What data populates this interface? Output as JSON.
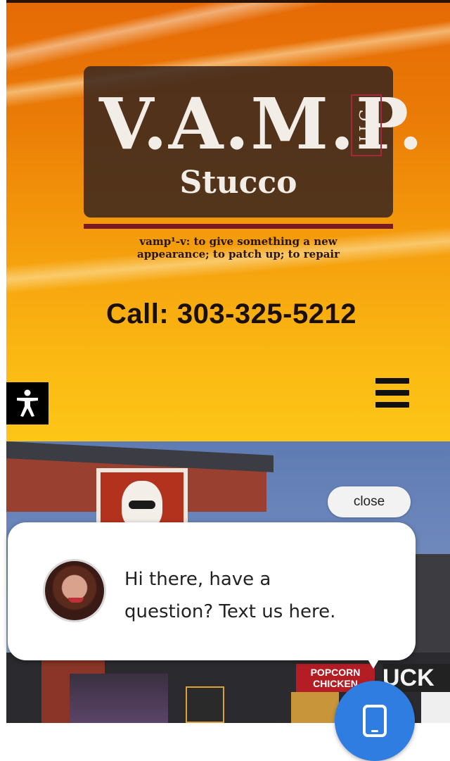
{
  "header": {
    "logo": {
      "letters": "V.A.M.P.",
      "llc": "LLC",
      "stucco": "Stucco"
    },
    "tagline_line1": "vamp¹-v: to give something a new",
    "tagline_line2": "appearance; to patch up; to repair",
    "call": "Call: 303-325-5212"
  },
  "icons": {
    "accessibility": "accessibility-icon",
    "menu": "hamburger-menu-icon",
    "phone": "mobile-phone-icon"
  },
  "hero_photo": {
    "signage_popcorn": "POPCORN\nCHICKEN",
    "signage_partial": "UCK"
  },
  "chat_widget": {
    "close_label": "close",
    "message_line1": "Hi there, have a",
    "message_line2": "question? Text us here."
  },
  "colors": {
    "fab": "#2f7de1",
    "logo_accent": "#b02a3a"
  }
}
